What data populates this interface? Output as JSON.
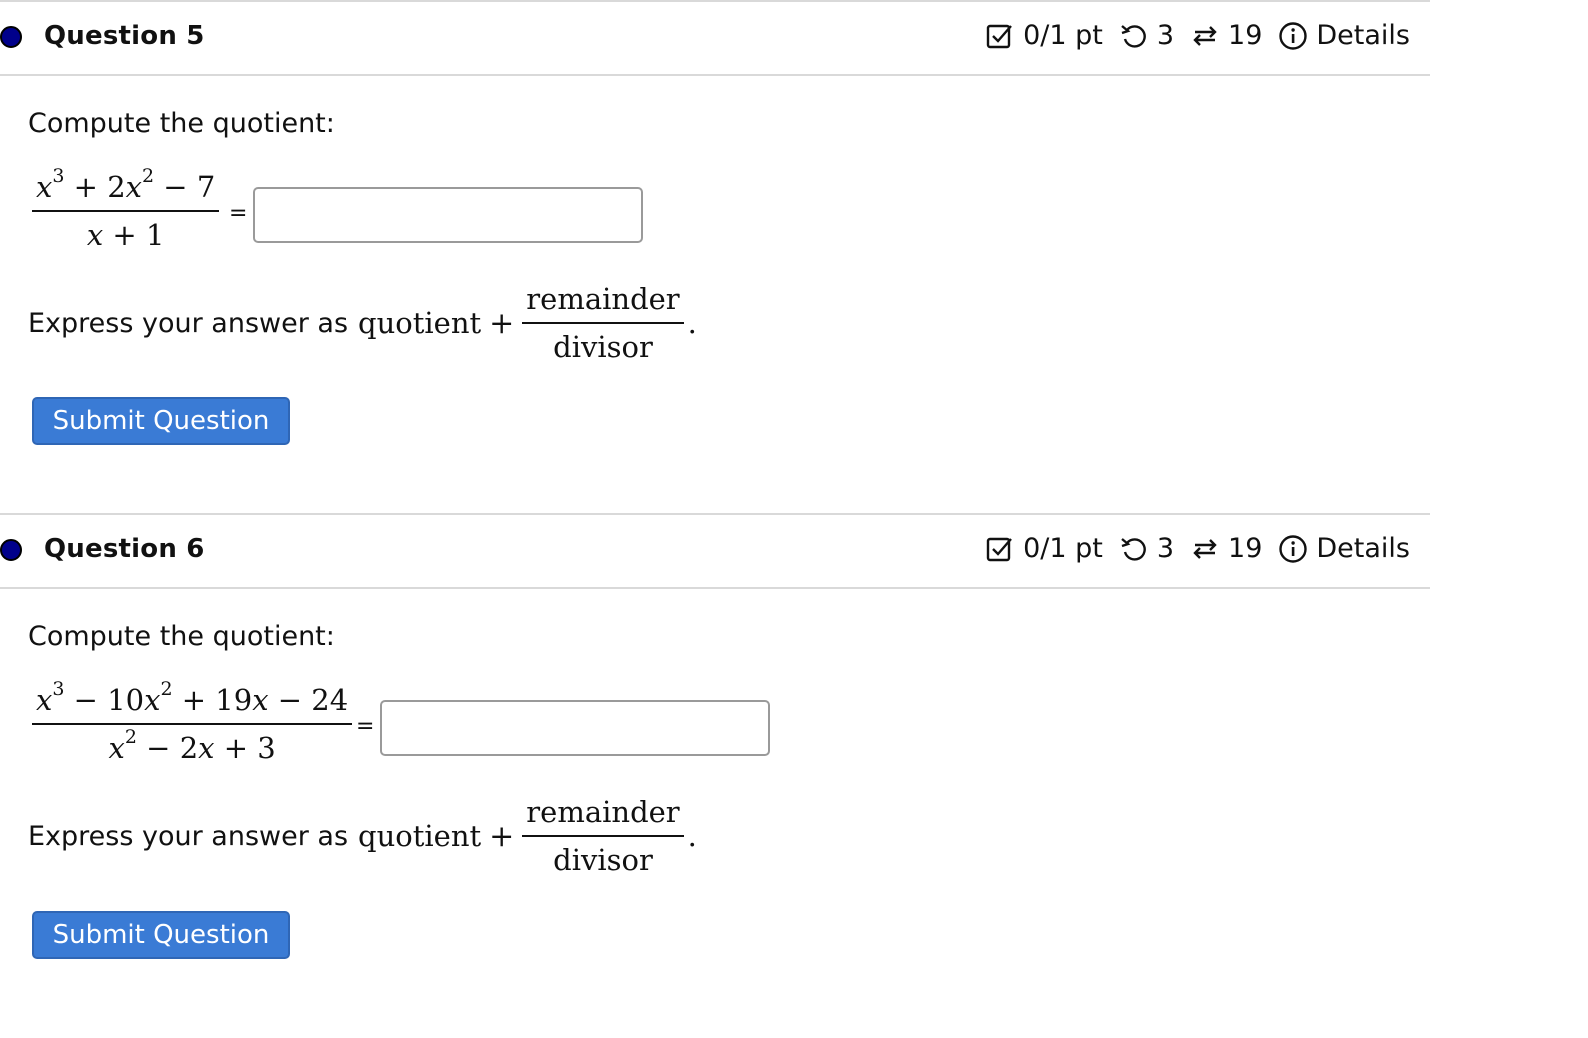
{
  "questions": [
    {
      "title": "Question 5",
      "meta": {
        "score": "0/1 pt",
        "retries": "3",
        "attempts": "19",
        "details": "Details"
      },
      "prompt": "Compute the quotient:",
      "equals": "=",
      "answer_value": "",
      "express_label": "Express your answer as",
      "quotient_word": "quotient",
      "plus": "+",
      "remainder_word": "remainder",
      "divisor_word": "divisor",
      "end_dot": ".",
      "submit_label": "Submit Question"
    },
    {
      "title": "Question 6",
      "meta": {
        "score": "0/1 pt",
        "retries": "3",
        "attempts": "19",
        "details": "Details"
      },
      "prompt": "Compute the quotient:",
      "equals": "=",
      "answer_value": "",
      "express_label": "Express your answer as",
      "quotient_word": "quotient",
      "plus": "+",
      "remainder_word": "remainder",
      "divisor_word": "divisor",
      "end_dot": ".",
      "submit_label": "Submit Question"
    }
  ],
  "icons": [
    "checkbox-score-icon",
    "retry-icon",
    "attempts-icon",
    "info-icon"
  ],
  "colors": {
    "status_dot": "#00008b",
    "submit_button": "#3a7bd5",
    "divider": "#d9d9d9"
  }
}
